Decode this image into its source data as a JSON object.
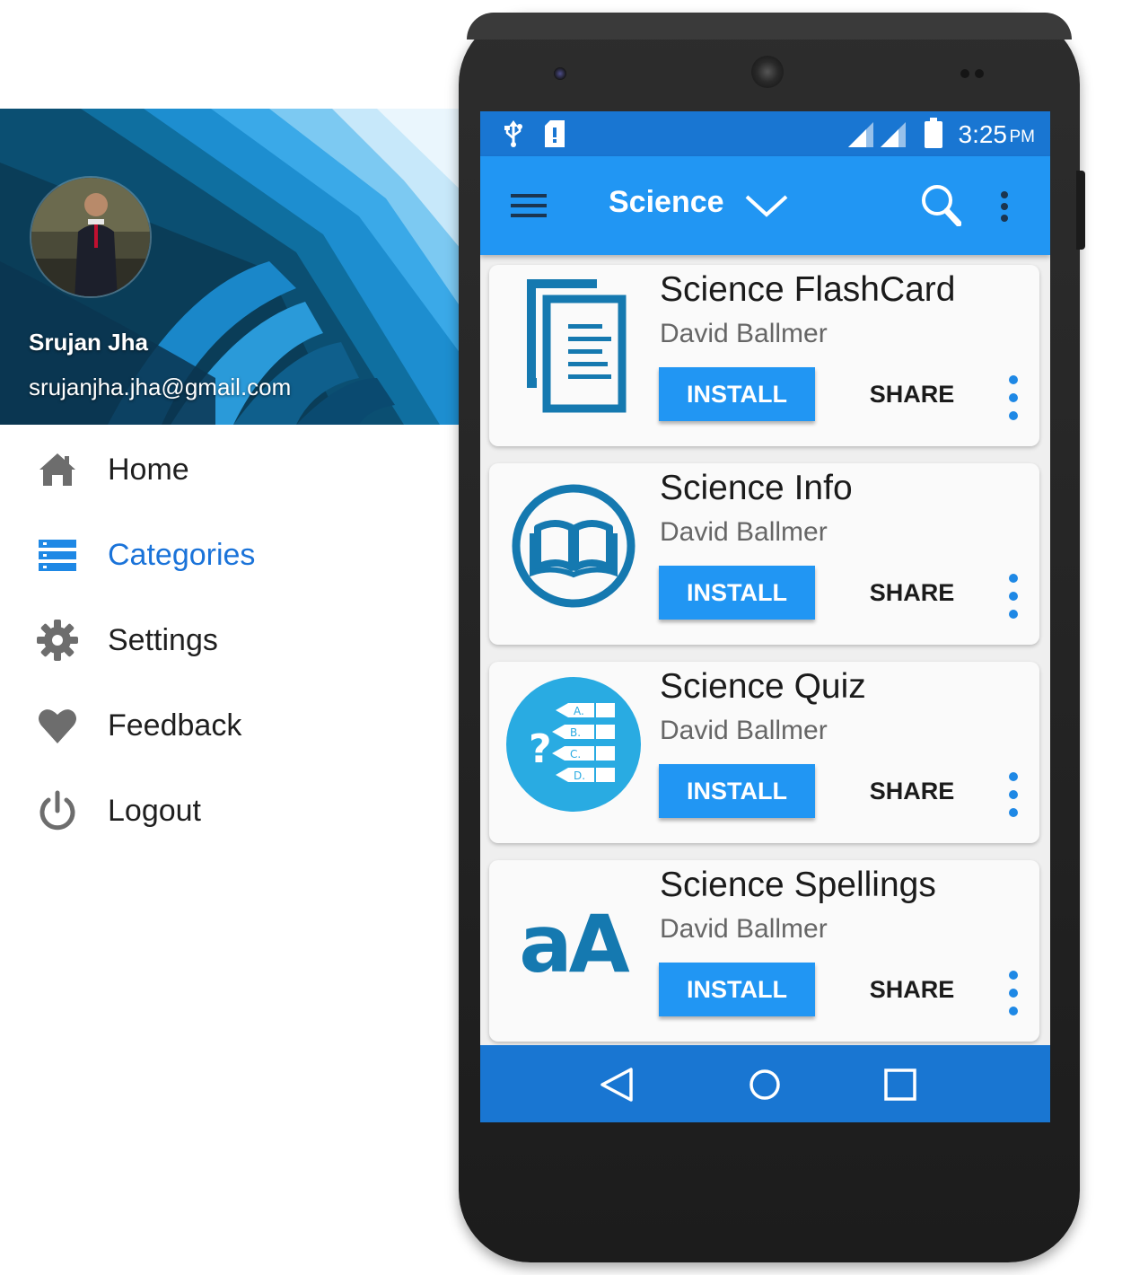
{
  "drawer": {
    "user": {
      "name": "Srujan Jha",
      "email": "srujanjha.jha@gmail.com"
    },
    "items": [
      {
        "label": "Home",
        "icon": "home-icon",
        "active": false
      },
      {
        "label": "Categories",
        "icon": "categories-icon",
        "active": true
      },
      {
        "label": "Settings",
        "icon": "gear-icon",
        "active": false
      },
      {
        "label": "Feedback",
        "icon": "heart-icon",
        "active": false
      },
      {
        "label": "Logout",
        "icon": "power-icon",
        "active": false
      }
    ]
  },
  "status_bar": {
    "time": "3:25",
    "ampm": "PM",
    "icons": [
      "usb-icon",
      "sd-card-icon",
      "signal-icon",
      "signal-icon",
      "battery-icon"
    ]
  },
  "app_bar": {
    "title": "Science",
    "icons": [
      "menu-icon",
      "chevron-down-icon",
      "search-icon",
      "more-vert-icon"
    ]
  },
  "apps": [
    {
      "title": "Science FlashCard",
      "author": "David Ballmer",
      "install_label": "INSTALL",
      "share_label": "SHARE",
      "icon": "flashcard-icon"
    },
    {
      "title": "Science Info",
      "author": "David Ballmer",
      "install_label": "INSTALL",
      "share_label": "SHARE",
      "icon": "book-icon"
    },
    {
      "title": "Science Quiz",
      "author": "David Ballmer",
      "install_label": "INSTALL",
      "share_label": "SHARE",
      "icon": "quiz-icon"
    },
    {
      "title": "Science Spellings",
      "author": "David Ballmer",
      "install_label": "INSTALL",
      "share_label": "SHARE",
      "icon": "spellings-icon",
      "icon_text": "aA"
    }
  ],
  "nav_bar": {
    "icons": [
      "back-icon",
      "home-circle-icon",
      "recents-icon"
    ]
  },
  "colors": {
    "primary": "#2196f3",
    "primary_dark": "#1976d2",
    "accent_text": "#1a73d9",
    "icon_blue": "#1579b0",
    "quiz_circle": "#29abe2"
  }
}
